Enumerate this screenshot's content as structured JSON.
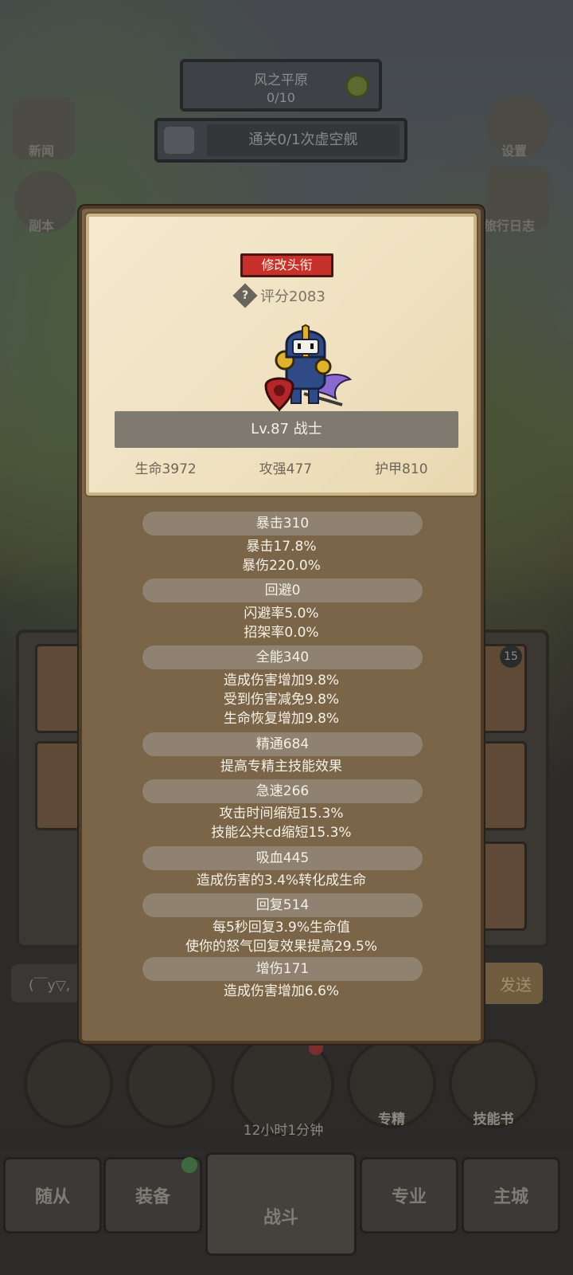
{
  "background": {
    "map_name": "风之平原",
    "map_progress": "0/10",
    "quest": "通关0/1次虚空舰",
    "left_icons": [
      "新闻",
      "副本"
    ],
    "right_icons": [
      "设置",
      "旅行日志"
    ],
    "card_badge": "15",
    "chat_placeholder": "(￣y▽,",
    "send_label": "发送",
    "round_buttons": [
      "专精",
      "技能书"
    ],
    "timer": "12小时1分钟",
    "nav": [
      "随从",
      "装备",
      "战斗",
      "专业",
      "主城"
    ]
  },
  "profile": {
    "title_button": "修改头衔",
    "score": "评分2083",
    "level_class": "Lv.87 战士",
    "hp": "生命3972",
    "atk": "攻强477",
    "armor": "护甲810"
  },
  "stats": [
    {
      "header": "暴击310",
      "lines": [
        "暴击17.8%",
        "暴伤220.0%"
      ]
    },
    {
      "header": "回避0",
      "lines": [
        "闪避率5.0%",
        "招架率0.0%"
      ]
    },
    {
      "header": "全能340",
      "lines": [
        "造成伤害增加9.8%",
        "受到伤害减免9.8%",
        "生命恢复增加9.8%"
      ]
    },
    {
      "header": "精通684",
      "lines": [
        "提高专精主技能效果"
      ]
    },
    {
      "header": "急速266",
      "lines": [
        "攻击时间缩短15.3%",
        "技能公共cd缩短15.3%"
      ]
    },
    {
      "header": "吸血445",
      "lines": [
        "造成伤害的3.4%转化成生命"
      ]
    },
    {
      "header": "回复514",
      "lines": [
        "每5秒回复3.9%生命值",
        "使你的怒气回复效果提高29.5%"
      ]
    },
    {
      "header": "增伤171",
      "lines": [
        "造成伤害增加6.6%"
      ]
    }
  ],
  "colors": {
    "modal_bg": "#7a6548",
    "card_bg": "#f0e3c3",
    "title_red": "#c8312b",
    "pill": "#8f8270"
  }
}
